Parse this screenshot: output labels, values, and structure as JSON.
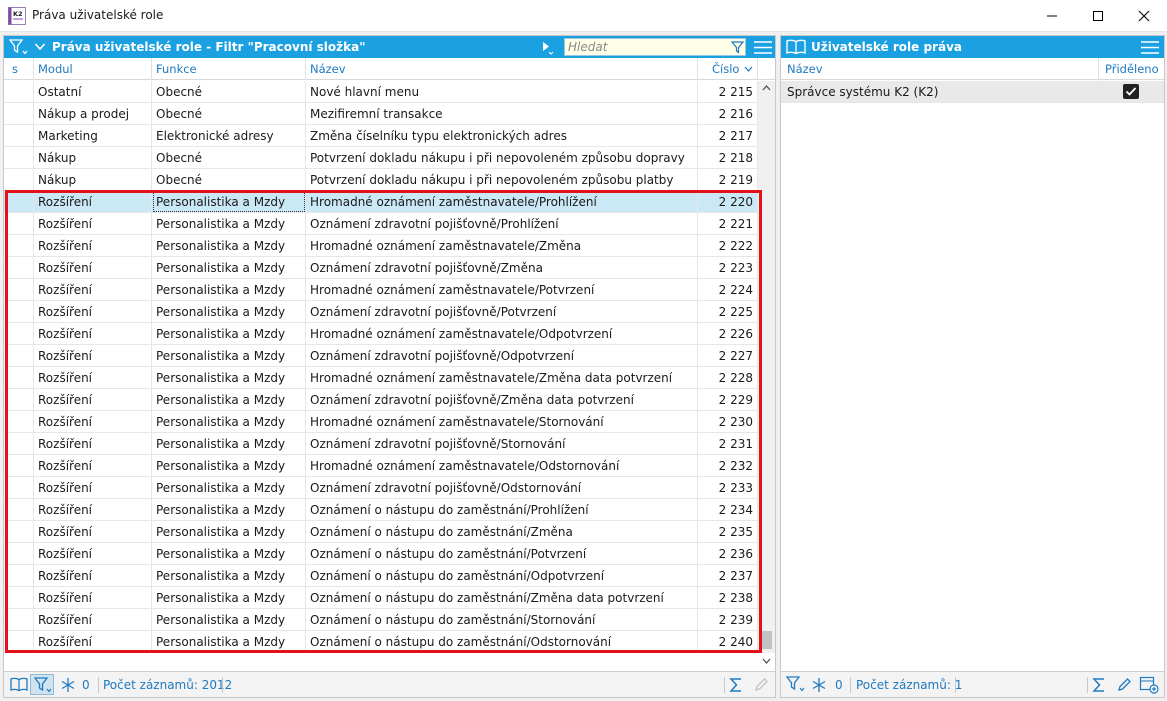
{
  "window": {
    "title": "Práva uživatelské role"
  },
  "left": {
    "title": "Práva uživatelské role - Filtr \"Pracovní složka\"",
    "search_placeholder": "Hledat",
    "columns": {
      "s": "s",
      "modul": "Modul",
      "funkce": "Funkce",
      "nazev": "Název",
      "cislo": "Číslo"
    },
    "rows": [
      {
        "modul": "Ostatní",
        "funkce": "Obecné",
        "nazev": "Nové hlavní menu",
        "cislo": "2 215"
      },
      {
        "modul": "Nákup a prodej",
        "funkce": "Obecné",
        "nazev": "Mezifiremní transakce",
        "cislo": "2 216"
      },
      {
        "modul": "Marketing",
        "funkce": "Elektronické adresy",
        "nazev": "Změna číselníku typu elektronických adres",
        "cislo": "2 217"
      },
      {
        "modul": "Nákup",
        "funkce": "Obecné",
        "nazev": "Potvrzení dokladu nákupu i při nepovoleném způsobu dopravy",
        "cislo": "2 218"
      },
      {
        "modul": "Nákup",
        "funkce": "Obecné",
        "nazev": "Potvrzení dokladu nákupu i při nepovoleném způsobu platby",
        "cislo": "2 219"
      },
      {
        "modul": "Rozšíření",
        "funkce": "Personalistika a Mzdy",
        "nazev": "Hromadné oznámení zaměstnavatele/Prohlížení",
        "cislo": "2 220"
      },
      {
        "modul": "Rozšíření",
        "funkce": "Personalistika a Mzdy",
        "nazev": "Oznámení zdravotní pojišťovně/Prohlížení",
        "cislo": "2 221"
      },
      {
        "modul": "Rozšíření",
        "funkce": "Personalistika a Mzdy",
        "nazev": "Hromadné oznámení zaměstnavatele/Změna",
        "cislo": "2 222"
      },
      {
        "modul": "Rozšíření",
        "funkce": "Personalistika a Mzdy",
        "nazev": "Oznámení zdravotní pojišťovně/Změna",
        "cislo": "2 223"
      },
      {
        "modul": "Rozšíření",
        "funkce": "Personalistika a Mzdy",
        "nazev": "Hromadné oznámení zaměstnavatele/Potvrzení",
        "cislo": "2 224"
      },
      {
        "modul": "Rozšíření",
        "funkce": "Personalistika a Mzdy",
        "nazev": "Oznámení zdravotní pojišťovně/Potvrzení",
        "cislo": "2 225"
      },
      {
        "modul": "Rozšíření",
        "funkce": "Personalistika a Mzdy",
        "nazev": "Hromadné oznámení zaměstnavatele/Odpotvrzení",
        "cislo": "2 226"
      },
      {
        "modul": "Rozšíření",
        "funkce": "Personalistika a Mzdy",
        "nazev": "Oznámení zdravotní pojišťovně/Odpotvrzení",
        "cislo": "2 227"
      },
      {
        "modul": "Rozšíření",
        "funkce": "Personalistika a Mzdy",
        "nazev": "Hromadné oznámení zaměstnavatele/Změna data potvrzení",
        "cislo": "2 228"
      },
      {
        "modul": "Rozšíření",
        "funkce": "Personalistika a Mzdy",
        "nazev": "Oznámení zdravotní pojišťovně/Změna data potvrzení",
        "cislo": "2 229"
      },
      {
        "modul": "Rozšíření",
        "funkce": "Personalistika a Mzdy",
        "nazev": "Hromadné oznámení zaměstnavatele/Stornování",
        "cislo": "2 230"
      },
      {
        "modul": "Rozšíření",
        "funkce": "Personalistika a Mzdy",
        "nazev": "Oznámení zdravotní pojišťovně/Stornování",
        "cislo": "2 231"
      },
      {
        "modul": "Rozšíření",
        "funkce": "Personalistika a Mzdy",
        "nazev": "Hromadné oznámení zaměstnavatele/Odstornování",
        "cislo": "2 232"
      },
      {
        "modul": "Rozšíření",
        "funkce": "Personalistika a Mzdy",
        "nazev": "Oznámení zdravotní pojišťovně/Odstornování",
        "cislo": "2 233"
      },
      {
        "modul": "Rozšíření",
        "funkce": "Personalistika a Mzdy",
        "nazev": "Oznámení o nástupu do zaměstnání/Prohlížení",
        "cislo": "2 234"
      },
      {
        "modul": "Rozšíření",
        "funkce": "Personalistika a Mzdy",
        "nazev": "Oznámení o nástupu do zaměstnání/Změna",
        "cislo": "2 235"
      },
      {
        "modul": "Rozšíření",
        "funkce": "Personalistika a Mzdy",
        "nazev": "Oznámení o nástupu do zaměstnání/Potvrzení",
        "cislo": "2 236"
      },
      {
        "modul": "Rozšíření",
        "funkce": "Personalistika a Mzdy",
        "nazev": "Oznámení o nástupu do zaměstnání/Odpotvrzení",
        "cislo": "2 237"
      },
      {
        "modul": "Rozšíření",
        "funkce": "Personalistika a Mzdy",
        "nazev": "Oznámení o nástupu do zaměstnání/Změna data potvrzení",
        "cislo": "2 238"
      },
      {
        "modul": "Rozšíření",
        "funkce": "Personalistika a Mzdy",
        "nazev": "Oznámení o nástupu do zaměstnání/Stornování",
        "cislo": "2 239"
      },
      {
        "modul": "Rozšíření",
        "funkce": "Personalistika a Mzdy",
        "nazev": "Oznámení o nástupu do zaměstnání/Odstornování",
        "cislo": "2 240"
      }
    ],
    "selected_index": 5,
    "status": {
      "count_zero": "0",
      "records": "Počet záznamů: 2012"
    }
  },
  "right": {
    "title": "Uživatelské role práva",
    "columns": {
      "nazev": "Název",
      "prideleno": "Přiděleno"
    },
    "rows": [
      {
        "nazev": "Správce systému K2 (K2)",
        "prideleno": true
      }
    ],
    "status": {
      "count_zero": "0",
      "records": "Počet záznamů: 1"
    }
  },
  "colors": {
    "accent": "#1ba1e2",
    "link": "#1f7ac0",
    "highlight": "#e3111a",
    "selected_row": "#cbe8f6"
  },
  "icons": [
    "app-logo-icon",
    "filter-icon",
    "chevron-down-icon",
    "hamburger-menu-icon",
    "book-icon",
    "play-arrow-icon",
    "snowflake-icon",
    "sigma-icon",
    "pencil-icon",
    "add-icon"
  ]
}
